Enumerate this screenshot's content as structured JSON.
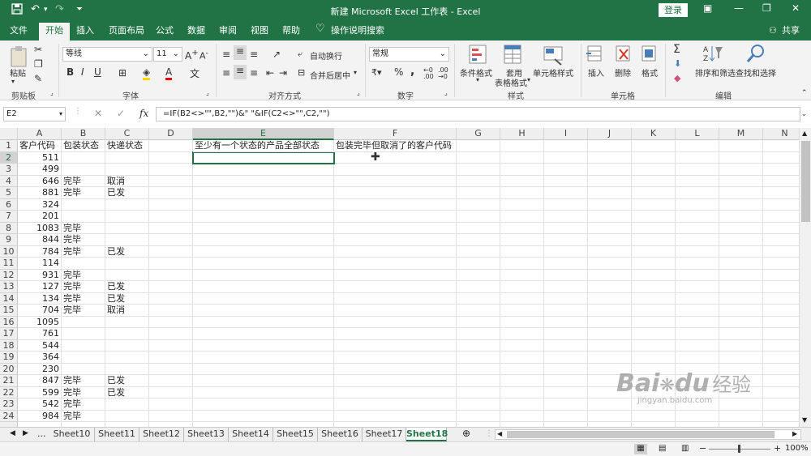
{
  "window": {
    "title": "新建 Microsoft Excel 工作表 - Excel",
    "login_label": "登录",
    "qa_icons": [
      "save-icon",
      "undo-icon",
      "redo-icon",
      "customize-icon"
    ]
  },
  "tabs": [
    "文件",
    "开始",
    "插入",
    "页面布局",
    "公式",
    "数据",
    "审阅",
    "视图",
    "帮助"
  ],
  "tell_me": "操作说明搜索",
  "share": "共享",
  "ribbon": {
    "clipboard": {
      "paste": "粘贴",
      "label": "剪贴板"
    },
    "font": {
      "name": "等线",
      "size": "11",
      "label": "字体",
      "bold": "B",
      "italic": "I",
      "underline": "U"
    },
    "alignment": {
      "wrap": "自动换行",
      "merge": "合并后居中",
      "label": "对齐方式"
    },
    "number": {
      "format": "常规",
      "label": "数字",
      "percent": "%",
      "comma": ","
    },
    "styles": {
      "conditional": "条件格式",
      "table_line1": "套用",
      "table_line2": "表格格式",
      "cell_styles": "单元格样式",
      "label": "样式"
    },
    "cells": {
      "insert": "插入",
      "delete": "删除",
      "format": "格式",
      "label": "单元格"
    },
    "editing": {
      "sort": "排序和筛选",
      "find": "查找和选择",
      "label": "编辑"
    }
  },
  "formula_bar": {
    "name_box": "E2",
    "cancel": "✕",
    "enter": "✓",
    "fx": "fx",
    "formula": "=IF(B2<>\"\",B2,\"\")&\" \"&IF(C2<>\"\",C2,\"\")"
  },
  "columns": [
    "A",
    "B",
    "C",
    "D",
    "E",
    "F",
    "G",
    "H",
    "I",
    "J",
    "K",
    "L",
    "M",
    "N"
  ],
  "rows": [
    {
      "n": "1",
      "A": "客户代码",
      "B": "包装状态",
      "C": "快递状态",
      "E": "至少有一个状态的产品全部状态",
      "F": "包装完毕但取消了的客户代码"
    },
    {
      "n": "2",
      "A": "511",
      "B": "",
      "C": ""
    },
    {
      "n": "3",
      "A": "499",
      "B": "",
      "C": ""
    },
    {
      "n": "4",
      "A": "646",
      "B": "完毕",
      "C": "取消"
    },
    {
      "n": "5",
      "A": "881",
      "B": "完毕",
      "C": "已发"
    },
    {
      "n": "6",
      "A": "324",
      "B": "",
      "C": ""
    },
    {
      "n": "7",
      "A": "201",
      "B": "",
      "C": ""
    },
    {
      "n": "8",
      "A": "1083",
      "B": "完毕",
      "C": ""
    },
    {
      "n": "9",
      "A": "844",
      "B": "完毕",
      "C": ""
    },
    {
      "n": "10",
      "A": "784",
      "B": "完毕",
      "C": "已发"
    },
    {
      "n": "11",
      "A": "114",
      "B": "",
      "C": ""
    },
    {
      "n": "12",
      "A": "931",
      "B": "完毕",
      "C": ""
    },
    {
      "n": "13",
      "A": "127",
      "B": "完毕",
      "C": "已发"
    },
    {
      "n": "14",
      "A": "134",
      "B": "完毕",
      "C": "已发"
    },
    {
      "n": "15",
      "A": "704",
      "B": "完毕",
      "C": "取消"
    },
    {
      "n": "16",
      "A": "1095",
      "B": "",
      "C": ""
    },
    {
      "n": "17",
      "A": "761",
      "B": "",
      "C": ""
    },
    {
      "n": "18",
      "A": "544",
      "B": "",
      "C": ""
    },
    {
      "n": "19",
      "A": "364",
      "B": "",
      "C": ""
    },
    {
      "n": "20",
      "A": "230",
      "B": "",
      "C": ""
    },
    {
      "n": "21",
      "A": "847",
      "B": "完毕",
      "C": "已发"
    },
    {
      "n": "22",
      "A": "599",
      "B": "完毕",
      "C": "已发"
    },
    {
      "n": "23",
      "A": "542",
      "B": "完毕",
      "C": ""
    },
    {
      "n": "24",
      "A": "984",
      "B": "完毕",
      "C": ""
    }
  ],
  "sheets": {
    "more": "...",
    "tabs": [
      "Sheet10",
      "Sheet11",
      "Sheet12",
      "Sheet13",
      "Sheet14",
      "Sheet15",
      "Sheet16",
      "Sheet17",
      "Sheet18"
    ],
    "active": "Sheet18"
  },
  "status": {
    "zoom": "100%",
    "minus": "−",
    "plus": "+"
  },
  "watermark": {
    "brand": "Bai",
    "brand2": "du",
    "cn": "经验",
    "url": "jingyan.baidu.com"
  },
  "colors": {
    "excel_green": "#217346",
    "ribbon_bg": "#f3f3f3"
  }
}
